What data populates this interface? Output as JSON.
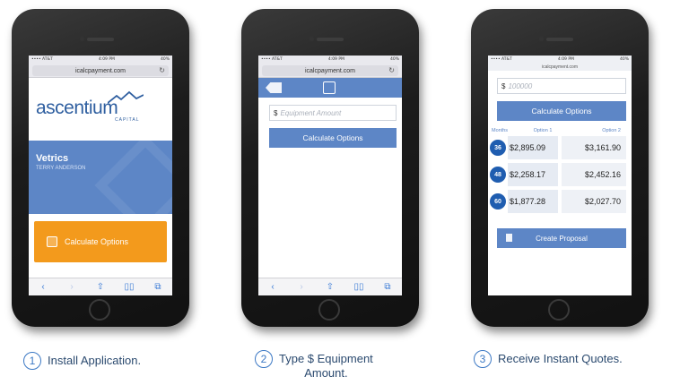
{
  "phone1": {
    "status_left": "•••• AT&T",
    "status_time": "4:09 PM",
    "status_right": "40%",
    "url": "icalcpayment.com",
    "logo_text": "ascentium",
    "logo_sub": "CAPITAL",
    "user_name": "Vetrics",
    "user_sub": "TERRY ANDERSON",
    "calc_button": "Calculate Options"
  },
  "phone2": {
    "status_left": "•••• AT&T",
    "status_time": "4:09 PM",
    "status_right": "40%",
    "url": "icalcpayment.com",
    "currency": "$",
    "amount_placeholder": "Equipment Amount",
    "calc_button": "Calculate Options"
  },
  "phone3": {
    "status_left": "•••• AT&T",
    "status_time": "4:09 PM",
    "status_right": "40%",
    "url": "icalcpayment.com",
    "currency": "$",
    "amount_value": "100000",
    "calc_button": "Calculate Options",
    "headers": {
      "months": "Months",
      "option1": "Option 1",
      "option2": "Option 2"
    },
    "rows": [
      {
        "months": "36",
        "option1": "$2,895.09",
        "option2": "$3,161.90"
      },
      {
        "months": "48",
        "option1": "$2,258.17",
        "option2": "$2,452.16"
      },
      {
        "months": "60",
        "option1": "$1,877.28",
        "option2": "$2,027.70"
      }
    ],
    "proposal_button": "Create Proposal"
  },
  "captions": [
    {
      "num": "1",
      "text": "Install Application."
    },
    {
      "num": "2",
      "text_line1": "Type $ Equipment",
      "text_line2": "Amount."
    },
    {
      "num": "3",
      "text": "Receive Instant Quotes."
    }
  ],
  "colors": {
    "accent_blue": "#5d86c6",
    "orange": "#f39a1c",
    "badge_blue": "#1f5db0"
  }
}
